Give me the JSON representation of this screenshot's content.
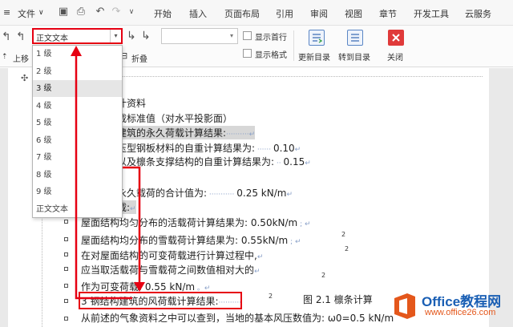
{
  "menubar": {
    "file": "文件",
    "items": [
      "开始",
      "插入",
      "页面布局",
      "引用",
      "审阅",
      "视图",
      "章节",
      "开发工具",
      "云服务"
    ]
  },
  "ribbon": {
    "level_select_value": "正文文本",
    "move_up_label": "上移",
    "collapse_label": "折叠",
    "show_first_line": "显示首行",
    "show_format": "显示格式",
    "update_toc": "更新目录",
    "goto_toc": "转到目录",
    "close": "关闭"
  },
  "dropdown": {
    "options": [
      "1 级",
      "2 级",
      "3 级",
      "4 级",
      "5 级",
      "6 级",
      "7 级",
      "8 级",
      "9 级",
      "正文文本"
    ],
    "selected_index": 2
  },
  "doc": {
    "lines": [
      "计资料",
      "载标准值（对水平投影面）",
      "建筑的永久荷载计算结果:",
      "压型钢板材料的自重计算结果为:",
      "0.10",
      "以及檩条支撑结构的自重计算结果为:",
      "0.15",
      "永久载荷的合计值为:",
      "0.25 kN/m",
      "载:",
      "屋面结构均匀分布的活载荷计算结果为: 0.50kN/m",
      "屋面结构均分布的雪载荷计算结果为: 0.55kN/m",
      "在对屋面结构的可变荷载进行计算过程中,",
      "应当取活载荷与雪载荷之间数值相对大的",
      "作为可变荷载: 0.55 kN/m",
      "3 钢结构建筑的风荷载计算结果:",
      "从前述的气象资料之中可以查到，当地的基本风压数值为: ω0=0.5 kN/m",
      "图 2.1  檩条计算"
    ],
    "superscript": "2"
  },
  "watermark": {
    "brand": "Office教程网",
    "url": "www.office26.com"
  },
  "colors": {
    "highlight_red": "#e60012",
    "brand_blue": "#1a5fb4",
    "brand_orange": "#e4571b"
  }
}
